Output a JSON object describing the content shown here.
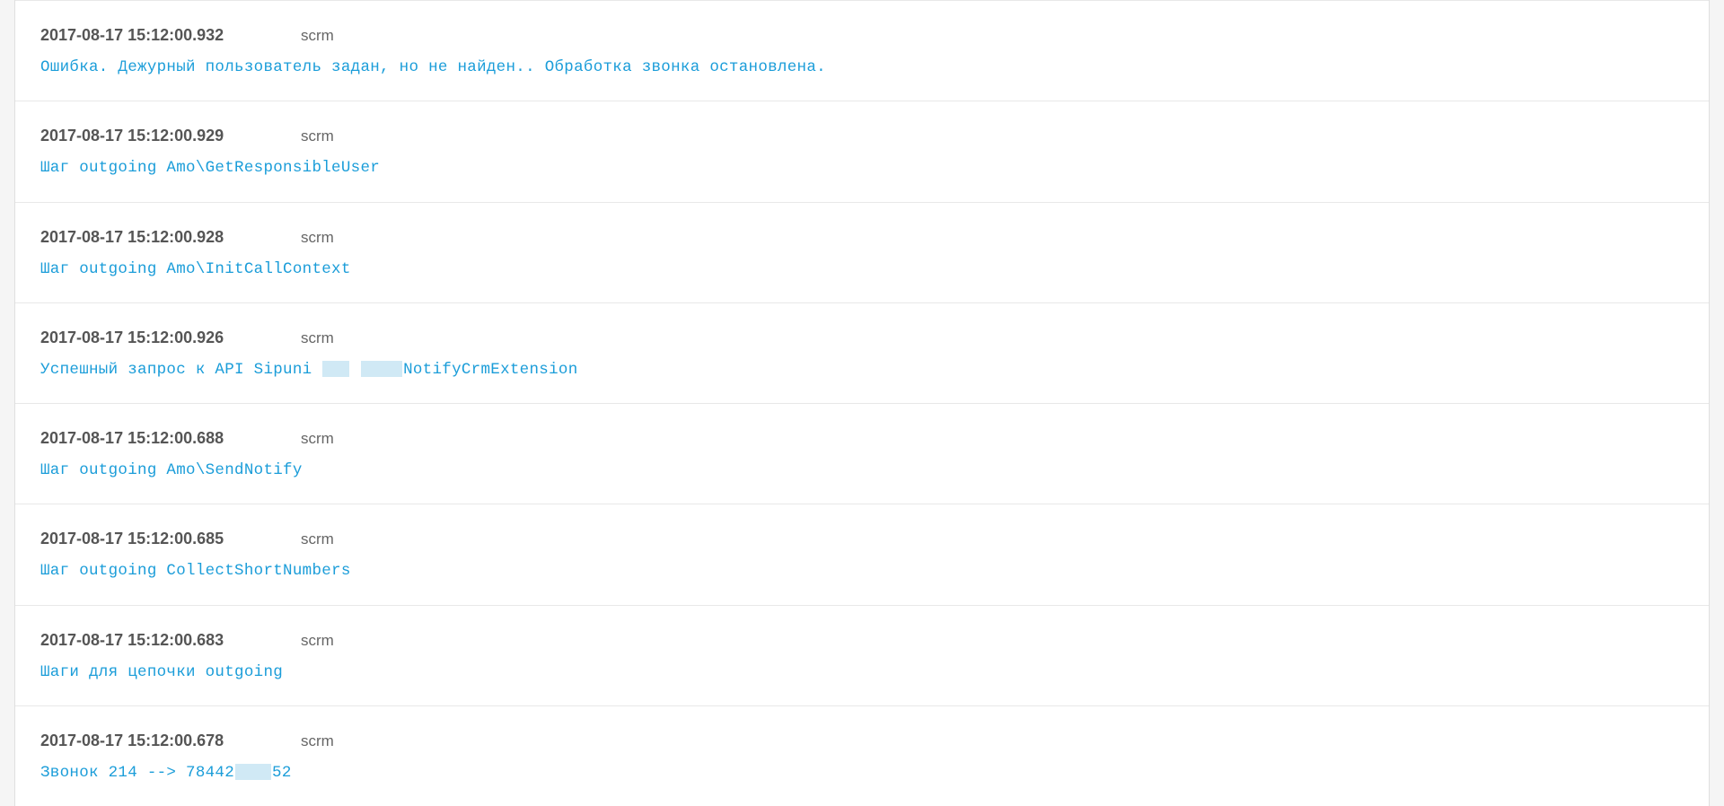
{
  "entries": [
    {
      "timestamp": "2017-08-17 15:12:00.932",
      "source": "scrm",
      "message_parts": [
        {
          "text": "Ошибка. Дежурный пользователь задан, но не найден.. Обработка звонка остановлена."
        }
      ]
    },
    {
      "timestamp": "2017-08-17 15:12:00.929",
      "source": "scrm",
      "message_parts": [
        {
          "text": "Шаг outgoing Amo\\GetResponsibleUser"
        }
      ]
    },
    {
      "timestamp": "2017-08-17 15:12:00.928",
      "source": "scrm",
      "message_parts": [
        {
          "text": "Шаг outgoing Amo\\InitCallContext"
        }
      ]
    },
    {
      "timestamp": "2017-08-17 15:12:00.926",
      "source": "scrm",
      "message_parts": [
        {
          "text": "Успешный запрос к API Sipuni "
        },
        {
          "redact": "w30"
        },
        {
          "text": " "
        },
        {
          "redact": "w46"
        },
        {
          "text": "NotifyCrmExtension"
        }
      ]
    },
    {
      "timestamp": "2017-08-17 15:12:00.688",
      "source": "scrm",
      "message_parts": [
        {
          "text": "Шаг outgoing Amo\\SendNotify"
        }
      ]
    },
    {
      "timestamp": "2017-08-17 15:12:00.685",
      "source": "scrm",
      "message_parts": [
        {
          "text": "Шаг outgoing CollectShortNumbers"
        }
      ]
    },
    {
      "timestamp": "2017-08-17 15:12:00.683",
      "source": "scrm",
      "message_parts": [
        {
          "text": "Шаги для цепочки outgoing"
        }
      ]
    },
    {
      "timestamp": "2017-08-17 15:12:00.678",
      "source": "scrm",
      "message_parts": [
        {
          "text": "Звонок 214 --> 78442"
        },
        {
          "redact": "w40"
        },
        {
          "text": "52"
        }
      ]
    }
  ]
}
